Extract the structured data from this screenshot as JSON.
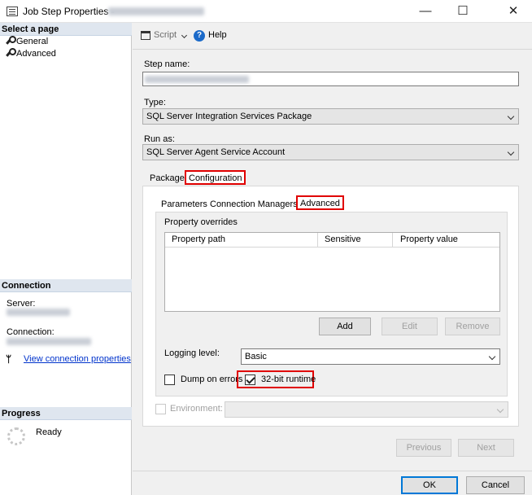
{
  "window": {
    "title": "Job Step Properties -",
    "minimize": "—",
    "maximize": "☐",
    "close": "✕"
  },
  "left": {
    "select_header": "Select a page",
    "pages": [
      {
        "label": "General"
      },
      {
        "label": "Advanced"
      }
    ],
    "connection_header": "Connection",
    "server_label": "Server:",
    "connection_label": "Connection:",
    "view_link": "View connection properties",
    "progress_header": "Progress",
    "progress_status": "Ready"
  },
  "toolbar": {
    "script_label": "Script",
    "help_label": "Help"
  },
  "form": {
    "step_name_label": "Step name:",
    "type_label": "Type:",
    "type_value": "SQL Server Integration Services Package",
    "run_as_label": "Run as:",
    "run_as_value": "SQL Server Agent Service Account"
  },
  "outer_tabs": [
    {
      "label": "Package"
    },
    {
      "label": "Configuration"
    }
  ],
  "inner_tabs": [
    {
      "label": "Parameters"
    },
    {
      "label": "Connection Managers"
    },
    {
      "label": "Advanced"
    }
  ],
  "advanced": {
    "overrides_label": "Property overrides",
    "columns": [
      "Property path",
      "Sensitive",
      "Property value"
    ],
    "add_label": "Add",
    "edit_label": "Edit",
    "remove_label": "Remove",
    "logging_label": "Logging level:",
    "logging_value": "Basic",
    "dump_label": "Dump on errors",
    "dump_checked": false,
    "runtime_label": "32-bit runtime",
    "runtime_checked": true
  },
  "environment": {
    "label": "Environment:"
  },
  "nav": {
    "previous_label": "Previous",
    "next_label": "Next"
  },
  "footer": {
    "ok_label": "OK",
    "cancel_label": "Cancel"
  }
}
